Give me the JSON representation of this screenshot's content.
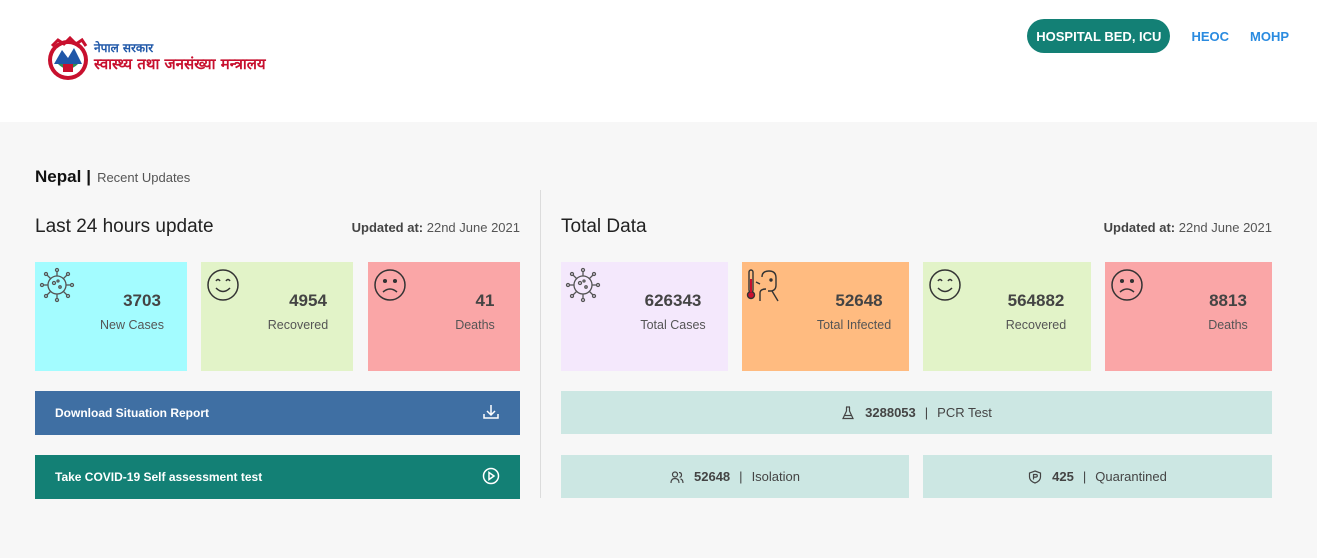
{
  "header": {
    "logo_line1": "नेपाल सरकार",
    "logo_line2": "स्वास्थ्य तथा जनसंख्या मन्त्रालय",
    "nav": {
      "hospital_bed": "HOSPITAL BED, ICU",
      "heoc": "HEOC",
      "mohp": "MOHP"
    }
  },
  "breadcrumb": {
    "country": "Nepal",
    "separator": "|",
    "subtitle": "Recent Updates"
  },
  "last24": {
    "title": "Last 24 hours update",
    "updated_label": "Updated at:",
    "updated_value": "22nd June 2021",
    "cards": [
      {
        "icon": "virus-icon",
        "value": "3703",
        "label": "New Cases",
        "color": "#a3fcff"
      },
      {
        "icon": "smile-icon",
        "value": "4954",
        "label": "Recovered",
        "color": "#e2f3c8"
      },
      {
        "icon": "sad-icon",
        "value": "41",
        "label": "Deaths",
        "color": "#faa6a7"
      }
    ],
    "download_report": "Download Situation Report",
    "self_assessment": "Take COVID-19 Self assessment test"
  },
  "total": {
    "title": "Total Data",
    "updated_label": "Updated at:",
    "updated_value": "22nd June 2021",
    "cards": [
      {
        "icon": "virus-icon",
        "value": "626343",
        "label": "Total Cases",
        "color": "#f4e8fc"
      },
      {
        "icon": "fever-icon",
        "value": "52648",
        "label": "Total Infected",
        "color": "#ffbb80"
      },
      {
        "icon": "smile-icon",
        "value": "564882",
        "label": "Recovered",
        "color": "#e2f3c8"
      },
      {
        "icon": "sad-icon",
        "value": "8813",
        "label": "Deaths",
        "color": "#faa6a7"
      }
    ],
    "pcr": {
      "icon": "flask-icon",
      "value": "3288053",
      "separator": "|",
      "label": "PCR Test"
    },
    "isolation": {
      "icon": "users-icon",
      "value": "52648",
      "separator": "|",
      "label": "Isolation"
    },
    "quarantined": {
      "icon": "shield-icon",
      "value": "425",
      "separator": "|",
      "label": "Quarantined"
    }
  },
  "colors": {
    "primary_teal": "#138075",
    "download_blue": "#3f6fa3",
    "link_blue": "#2a8be0",
    "stat_bar": "#cce7e3"
  }
}
